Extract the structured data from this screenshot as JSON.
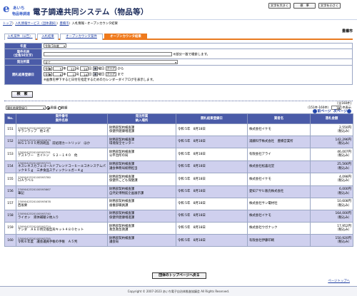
{
  "header": {
    "logo_letter": "e",
    "logo_ai": "あいち",
    "logo_sub": "物品等調達",
    "title": "電子調達共同システム（物品等）",
    "buttons": [
      "文字を大きく",
      "標　準",
      "文字を小さく"
    ],
    "org": "豊橋市"
  },
  "breadcrumb": [
    {
      "text": "トップ",
      "link": true
    },
    {
      "text": "〉",
      "link": false
    },
    {
      "text": "入札情報サービス（団体選択）",
      "link": true
    },
    {
      "text": "〉",
      "link": false
    },
    {
      "text": "豊橋市",
      "link": true
    },
    {
      "text": "〉入札情報・オープンカウンタ結果",
      "link": false
    }
  ],
  "tabs": [
    "入札案件（公告）",
    "入札結果",
    "オープンカウンタ案件",
    "オープンカウンタ結果"
  ],
  "form": {
    "year_label": "年度",
    "year_value": "令和 5年度",
    "name_label": "案件名称",
    "name_label2": "（全角50文字）",
    "name_note": "※部分一致で検索します。",
    "category_label": "発注所属",
    "category_value": "全て",
    "date_label": "開札結果登録日",
    "from": {
      "era": "令和",
      "year": "5",
      "month": "12",
      "day": "14"
    },
    "to": {
      "era": "令和",
      "year": "6",
      "month": "1",
      "day": "14"
    },
    "unit_year": "年",
    "unit_month": "月",
    "unit_day": "日",
    "cal_label": "曜日",
    "clear_label": "クリア",
    "from_suffix": "から",
    "to_suffix": "まで",
    "calendar_note": "※画像を押下すると日付を指定するためのカレンダーダイアログを表示します。",
    "search_button": "検　索"
  },
  "sort": {
    "field": "開札結果登録日",
    "asc": "昇順",
    "desc": "降順"
  },
  "counts": {
    "total": "[全160件]",
    "range": "（151件-160件）",
    "per_page": "10",
    "per_page_unit": "件表示"
  },
  "pager": {
    "prev": "前ページ",
    "next": "次ページ"
  },
  "table": {
    "headers": [
      "No.",
      "案件番号\n案件名称",
      "発注所属\n納入場所",
      "開札結果登録日",
      "業者名",
      "落札金額"
    ],
    "rows": [
      {
        "no": "151",
        "code": "2309042320100593796",
        "name": "サランラップ　他２点",
        "dept": "財務部契約検査課",
        "place": "保健所健康増進課",
        "date": "令和 5年　8月18日",
        "vendor": "株式会社イケモ",
        "price": "2,550円",
        "status": "（税込み）"
      },
      {
        "no": "152",
        "code": "2309042320100593679",
        "name": "ＷＧ１０００用消耗品　前処理カートリッジ　ほか",
        "dept": "財務部契約検査課",
        "place": "環境保全センター",
        "date": "令和 5年　8月18日",
        "vendor": "湯藤科学株式会社　豊橋営業所",
        "price": "142,296円",
        "status": "（税込み）"
      },
      {
        "no": "153",
        "code": "2309042320100593791",
        "name": "デストワー　カイトン　Ｓ２－１４０　他",
        "dept": "財務部契約検査課",
        "place": "公平治所の局",
        "date": "令和 5年　8月18日",
        "vendor": "有限会社アライ",
        "price": "46,007円",
        "status": "（税込み）"
      },
      {
        "no": "154",
        "code": "2309042320100593723",
        "name": "ネスレネスカフェゴールドブレンドコーヒーエコネシステムパック９５ｇ　三井食品スティックシュガー４ｇ",
        "dept": "財務部契約検査課",
        "place": "議会事務局総務担当",
        "date": "令和 5年　8月18日",
        "vendor": "株式会社松喜北堂",
        "price": "25,566円",
        "status": "（税込み）"
      },
      {
        "no": "155",
        "code": "2309042320100593780",
        "name": "ロＡラベル",
        "dept": "財務部契約検査課",
        "place": "保健所こども保健課",
        "date": "令和 5年　8月18日",
        "vendor": "株式会社イケモ",
        "price": "4,098円",
        "status": "（税込み）"
      },
      {
        "no": "156",
        "code": "2309042320100593667",
        "name": "筆記",
        "dept": "財務部契約検査課",
        "place": "自然史博物館企画展示課",
        "date": "令和 5年　8月18日",
        "vendor": "愛知アサヒ販売株式会社",
        "price": "6,000円",
        "status": "（税込み）"
      },
      {
        "no": "157",
        "code": "2309042320100593678",
        "name": "西坂栗",
        "dept": "財務部契約検査課",
        "place": "歯養部職員課",
        "date": "令和 5年　8月18日",
        "vendor": "株式会社サン電材社",
        "price": "10,608円",
        "status": "（税込み）"
      },
      {
        "no": "158",
        "code": "2309042320100593740",
        "name": "ライオン　液体補聴２枚入り",
        "dept": "財務部契約検査課",
        "place": "保健所健康増進課",
        "date": "令和 5年　8月18日",
        "vendor": "株式会社イケモ",
        "price": "164,000円",
        "status": "（税込み）"
      },
      {
        "no": "159",
        "code": "2309042320100593724",
        "name": "テンダ　ＡＥＤ用交換型形キット４８０セット",
        "dept": "財務部契約検査課",
        "place": "救急救急救課",
        "date": "令和 5年　8月18日",
        "vendor": "株式会社ウガナック",
        "price": "17,952円",
        "status": "（税込み）"
      },
      {
        "no": "160",
        "code": "2309042320100593755",
        "name": "令和６年度　議会議員手帳の手帳　Ａ５判",
        "dept": "財務部契約検査課",
        "place": "議会局",
        "date": "令和 5年　8月18日",
        "vendor": "有限会社伊藤印刷",
        "price": "150,920円",
        "status": "（税込み）"
      }
    ]
  },
  "top_button": "団体のトップページへ戻る",
  "page_top": "ページトップへ",
  "footer": "Copyright © 2007-2023 あいち電子自治体推進協議会 All Rights Reserved."
}
